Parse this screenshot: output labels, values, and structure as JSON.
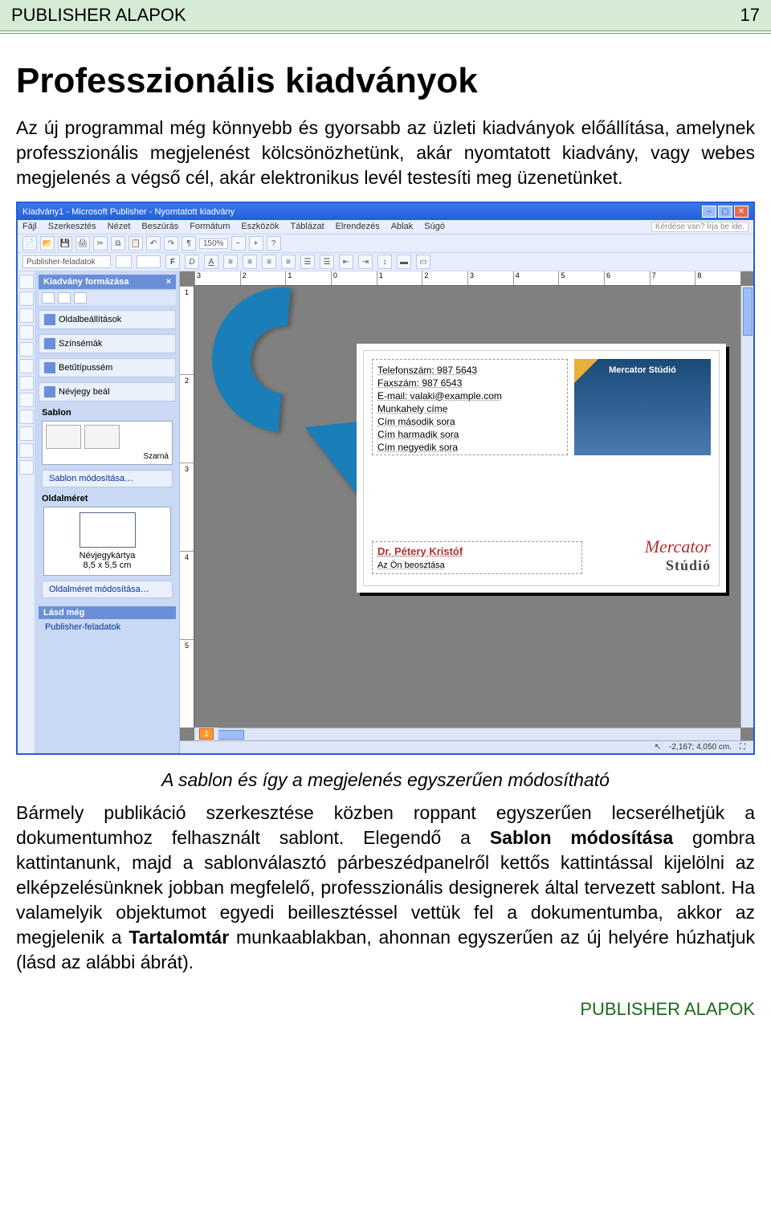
{
  "header": {
    "left": "PUBLISHER ALAPOK",
    "page_number": "17"
  },
  "title": "Professzionális kiadványok",
  "lead": "Az új programmal még könnyebb és gyorsabb az üzleti kiadványok előállítása, amelynek professzionális megjelenést kölcsönözhetünk, akár nyomtatott kiadvány, vagy webes megjelenés a végső cél, akár elektronikus levél testesíti meg üzenetünket.",
  "caption": "A sablon és így a megjelenés egyszerűen módosítható",
  "body_parts": {
    "p1": "Bármely publikáció szerkesztése közben roppant egyszerűen lecserélhetjük a dokumentumhoz felhasznált sablont. Elegendő a ",
    "b1": "Sablon módosítása",
    "p2": " gombra kattintanunk, majd a sablonválasztó párbeszédpanelről kettős kattintással kijelölni az elképzelésünknek jobban megfelelő, professzionális designerek által tervezett sablont. Ha valamelyik objektumot egyedi beillesztéssel vettük fel a dokumentumba, akkor az megjelenik a ",
    "b2": "Tartalomtár",
    "p3": " munkaablakban, ahonnan egyszerűen az új helyére húzhatjuk (lásd az alábbi ábrát)."
  },
  "footer": "PUBLISHER ALAPOK",
  "app": {
    "title": "Kiadvány1 - Microsoft Publisher - Nyomtatott kiadvány",
    "menus": [
      "Fájl",
      "Szerkesztés",
      "Nézet",
      "Beszúrás",
      "Formátum",
      "Eszközök",
      "Táblázat",
      "Elrendezés",
      "Ablak",
      "Súgó"
    ],
    "help_placeholder": "Kérdése van? Írja be ide.",
    "zoom": "150%",
    "toolbar2_label": "Publisher-feladatok",
    "taskpane": {
      "title": "Kiadvány formázása",
      "items": [
        "Oldalbeállítások",
        "Színsémák",
        "Betűtípussém",
        "Névjegy beál"
      ],
      "sablon": "Sablon",
      "szarna": "Szarná",
      "sablon_mod": "Sablon módosítása…",
      "oldalmeret": "Oldalméret",
      "size_name": "Névjegykártya",
      "size_dim": "8,5 x 5,5 cm",
      "size_link": "Oldalméret módosítása…",
      "lasd": "Lásd még",
      "lasd_link": "Publisher-feladatok"
    },
    "ruler_h": [
      "3",
      "2",
      "1",
      "0",
      "1",
      "2",
      "3",
      "4",
      "5",
      "6",
      "7",
      "8"
    ],
    "ruler_v": [
      "1",
      "2",
      "3",
      "4",
      "5"
    ],
    "bizcard": {
      "tel": "Telefonszám: 987 5643",
      "fax": "Faxszám: 987 6543",
      "email": "E-mail: valaki@example.com",
      "work": "Munkahely címe",
      "addr2": "Cím második sora",
      "addr3": "Cím harmadik sora",
      "addr4": "Cím negyedik sora",
      "chip": "Mercator Stúdió",
      "name": "Dr. Pétery Kristóf",
      "role": "Az Ön beosztása",
      "logo1": "Mercator",
      "logo2": "Stúdió"
    },
    "page_nav": "1",
    "status": "-2,167; 4,050 cm."
  }
}
